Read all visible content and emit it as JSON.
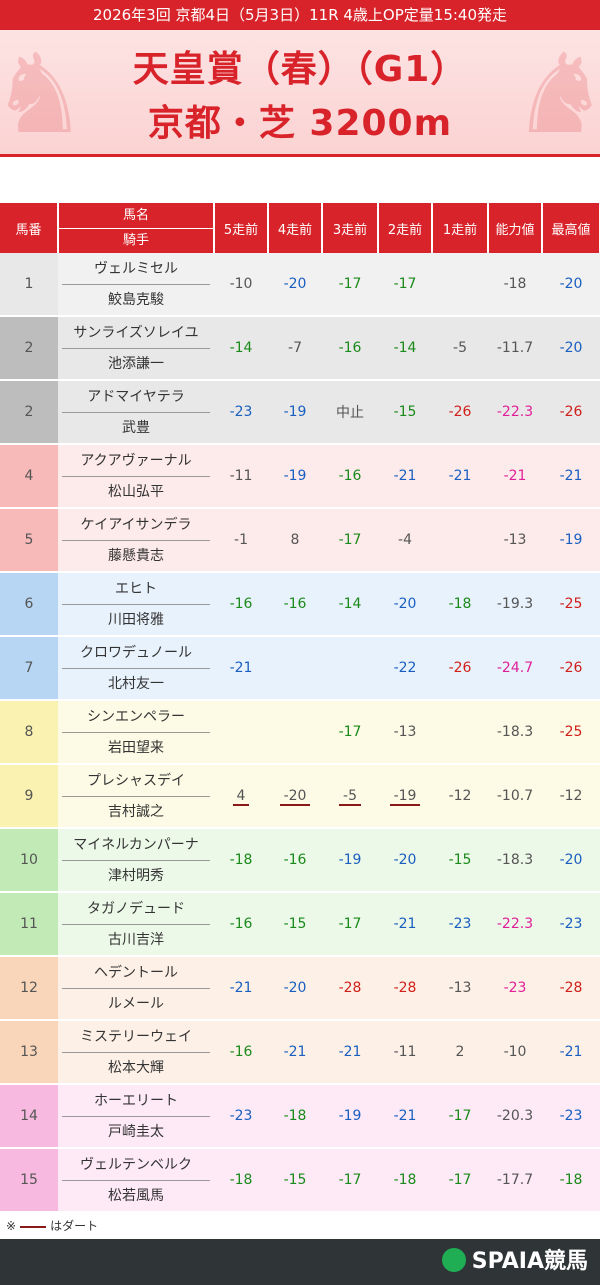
{
  "header": {
    "race_info": "2026年3回 京都4日（5月3日）11R 4歳上OP定量15:40発走",
    "title_line1": "天皇賞（春）（G1）",
    "title_line2": "京都・芝 3200m"
  },
  "columns": {
    "umaban": "馬番",
    "horse": "馬名",
    "jockey": "騎手",
    "r5": "5走前",
    "r4": "4走前",
    "r3": "3走前",
    "r2": "2走前",
    "r1": "1走前",
    "ability": "能力値",
    "max": "最高値"
  },
  "colors": {
    "accent": "#d8232a",
    "green": "#1a8a1a",
    "blue": "#1a5fc0",
    "red": "#d0201a",
    "pink": "#e0209a"
  },
  "rows": [
    {
      "no": "1",
      "horse": "ヴェルミセル",
      "jockey": "鮫島克駿",
      "r5": "-10",
      "r4": "-20",
      "r3": "-17",
      "r2": "-17",
      "r1": "",
      "ability": "-18",
      "max": "-20",
      "c5": "k",
      "c4": "b",
      "c3": "g",
      "c2": "g",
      "c1": "k",
      "ca": "k",
      "cm": "b",
      "bg": "#f1f1f1",
      "nbg": "#e8e8e8"
    },
    {
      "no": "2",
      "horse": "サンライズソレイユ",
      "jockey": "池添謙一",
      "r5": "-14",
      "r4": "-7",
      "r3": "-16",
      "r2": "-14",
      "r1": "-5",
      "ability": "-11.7",
      "max": "-20",
      "c5": "g",
      "c4": "k",
      "c3": "g",
      "c2": "g",
      "c1": "k",
      "ca": "k",
      "cm": "b",
      "bg": "#e8e8e8",
      "nbg": "#bdbdbd"
    },
    {
      "no": "2",
      "horse": "アドマイヤテラ",
      "jockey": "武豊",
      "r5": "-23",
      "r4": "-19",
      "r3": "中止",
      "r2": "-15",
      "r1": "-26",
      "ability": "-22.3",
      "max": "-26",
      "c5": "b",
      "c4": "b",
      "c3": "k",
      "c2": "g",
      "c1": "r",
      "ca": "p",
      "cm": "r",
      "bg": "#e8e8e8",
      "nbg": "#bdbdbd"
    },
    {
      "no": "4",
      "horse": "アクアヴァーナル",
      "jockey": "松山弘平",
      "r5": "-11",
      "r4": "-19",
      "r3": "-16",
      "r2": "-21",
      "r1": "-21",
      "ability": "-21",
      "max": "-21",
      "c5": "k",
      "c4": "b",
      "c3": "g",
      "c2": "b",
      "c1": "b",
      "ca": "p",
      "cm": "b",
      "bg": "#fdeaea",
      "nbg": "#f8b9b9"
    },
    {
      "no": "5",
      "horse": "ケイアイサンデラ",
      "jockey": "藤懸貴志",
      "r5": "-1",
      "r4": "8",
      "r3": "-17",
      "r2": "-4",
      "r1": "",
      "ability": "-13",
      "max": "-19",
      "c5": "k",
      "c4": "k",
      "c3": "g",
      "c2": "k",
      "c1": "k",
      "ca": "k",
      "cm": "b",
      "bg": "#fdeaea",
      "nbg": "#f8b9b9"
    },
    {
      "no": "6",
      "horse": "エヒト",
      "jockey": "川田将雅",
      "r5": "-16",
      "r4": "-16",
      "r3": "-14",
      "r2": "-20",
      "r1": "-18",
      "ability": "-19.3",
      "max": "-25",
      "c5": "g",
      "c4": "g",
      "c3": "g",
      "c2": "b",
      "c1": "g",
      "ca": "k",
      "cm": "r",
      "bg": "#e8f2fc",
      "nbg": "#b7d6f3"
    },
    {
      "no": "7",
      "horse": "クロワデュノール",
      "jockey": "北村友一",
      "r5": "-21",
      "r4": "",
      "r3": "",
      "r2": "-22",
      "r1": "-26",
      "ability": "-24.7",
      "max": "-26",
      "c5": "b",
      "c4": "k",
      "c3": "k",
      "c2": "b",
      "c1": "r",
      "ca": "p",
      "cm": "r",
      "bg": "#e8f2fc",
      "nbg": "#b7d6f3"
    },
    {
      "no": "8",
      "horse": "シンエンペラー",
      "jockey": "岩田望来",
      "r5": "",
      "r4": "",
      "r3": "-17",
      "r2": "-13",
      "r1": "",
      "ability": "-18.3",
      "max": "-25",
      "c5": "k",
      "c4": "k",
      "c3": "g",
      "c2": "k",
      "c1": "k",
      "ca": "k",
      "cm": "r",
      "bg": "#fdfbe6",
      "nbg": "#f9f2b0"
    },
    {
      "no": "9",
      "horse": "プレシャスデイ",
      "jockey": "吉村誠之",
      "r5": "4",
      "r4": "-20",
      "r3": "-5",
      "r2": "-19",
      "r1": "-12",
      "ability": "-10.7",
      "max": "-12",
      "c5": "k",
      "c4": "k",
      "c3": "k",
      "c2": "k",
      "c1": "k",
      "ca": "k",
      "cm": "k",
      "bg": "#fdfbe6",
      "nbg": "#f9f2b0",
      "dirt": [
        "r5",
        "r4",
        "r3",
        "r2"
      ]
    },
    {
      "no": "10",
      "horse": "マイネルカンパーナ",
      "jockey": "津村明秀",
      "r5": "-18",
      "r4": "-16",
      "r3": "-19",
      "r2": "-20",
      "r1": "-15",
      "ability": "-18.3",
      "max": "-20",
      "c5": "g",
      "c4": "g",
      "c3": "b",
      "c2": "b",
      "c1": "g",
      "ca": "k",
      "cm": "b",
      "bg": "#ecf8e8",
      "nbg": "#c2eab6"
    },
    {
      "no": "11",
      "horse": "タガノデュード",
      "jockey": "古川吉洋",
      "r5": "-16",
      "r4": "-15",
      "r3": "-17",
      "r2": "-21",
      "r1": "-23",
      "ability": "-22.3",
      "max": "-23",
      "c5": "g",
      "c4": "g",
      "c3": "g",
      "c2": "b",
      "c1": "b",
      "ca": "p",
      "cm": "b",
      "bg": "#ecf8e8",
      "nbg": "#c2eab6"
    },
    {
      "no": "12",
      "horse": "ヘデントール",
      "jockey": "ルメール",
      "r5": "-21",
      "r4": "-20",
      "r3": "-28",
      "r2": "-28",
      "r1": "-13",
      "ability": "-23",
      "max": "-28",
      "c5": "b",
      "c4": "b",
      "c3": "r",
      "c2": "r",
      "c1": "k",
      "ca": "p",
      "cm": "r",
      "bg": "#fdf0e6",
      "nbg": "#f9d5b9"
    },
    {
      "no": "13",
      "horse": "ミステリーウェイ",
      "jockey": "松本大輝",
      "r5": "-16",
      "r4": "-21",
      "r3": "-21",
      "r2": "-11",
      "r1": "2",
      "ability": "-10",
      "max": "-21",
      "c5": "g",
      "c4": "b",
      "c3": "b",
      "c2": "k",
      "c1": "k",
      "ca": "k",
      "cm": "b",
      "bg": "#fdf0e6",
      "nbg": "#f9d5b9"
    },
    {
      "no": "14",
      "horse": "ホーエリート",
      "jockey": "戸崎圭太",
      "r5": "-23",
      "r4": "-18",
      "r3": "-19",
      "r2": "-21",
      "r1": "-17",
      "ability": "-20.3",
      "max": "-23",
      "c5": "b",
      "c4": "g",
      "c3": "b",
      "c2": "b",
      "c1": "g",
      "ca": "k",
      "cm": "b",
      "bg": "#fdeaf6",
      "nbg": "#f8b9e0"
    },
    {
      "no": "15",
      "horse": "ヴェルテンベルク",
      "jockey": "松若風馬",
      "r5": "-18",
      "r4": "-15",
      "r3": "-17",
      "r2": "-18",
      "r1": "-17",
      "ability": "-17.7",
      "max": "-18",
      "c5": "g",
      "c4": "g",
      "c3": "g",
      "c2": "g",
      "c1": "g",
      "ca": "k",
      "cm": "g",
      "bg": "#fdeaf6",
      "nbg": "#f8b9e0"
    }
  ],
  "note": {
    "prefix": "※",
    "suffix": "はダート"
  },
  "footer": {
    "logo": "SPAIA競馬"
  }
}
